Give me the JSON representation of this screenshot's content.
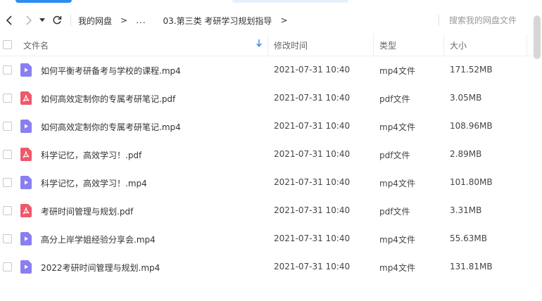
{
  "colors": {
    "accent": "#2d8cf0",
    "mp4_icon": "#8a7ff0",
    "pdf_icon": "#f0586a"
  },
  "nav": {
    "back_icon": "arrow-left-icon",
    "forward_icon": "arrow-right-icon",
    "dropdown_icon": "caret-down-icon",
    "refresh_icon": "refresh-icon"
  },
  "breadcrumb": {
    "root": "我的网盘",
    "sep": ">",
    "ellipsis": "...",
    "current": "03.第三类 考研学习规划指导",
    "trailing_sep": ">"
  },
  "search": {
    "placeholder": "搜索我的网盘文件"
  },
  "columns": {
    "name": "文件名",
    "mtime": "修改时间",
    "type": "类型",
    "size": "大小",
    "sort_icon": "sort-down-arrow-icon"
  },
  "files": [
    {
      "name": "如何平衡考研备考与学校的课程.mp4",
      "mtime": "2021-07-31 10:40",
      "type": "mp4文件",
      "size": "171.52MB",
      "icon": "video-file-icon"
    },
    {
      "name": "如何高效定制你的专属考研笔记.pdf",
      "mtime": "2021-07-31 10:40",
      "type": "pdf文件",
      "size": "3.05MB",
      "icon": "pdf-file-icon"
    },
    {
      "name": "如何高效定制你的专属考研笔记.mp4",
      "mtime": "2021-07-31 10:40",
      "type": "mp4文件",
      "size": "108.96MB",
      "icon": "video-file-icon"
    },
    {
      "name": "科学记忆，高效学习！.pdf",
      "mtime": "2021-07-31 10:40",
      "type": "pdf文件",
      "size": "2.89MB",
      "icon": "pdf-file-icon"
    },
    {
      "name": "科学记忆，高效学习！.mp4",
      "mtime": "2021-07-31 10:40",
      "type": "mp4文件",
      "size": "101.80MB",
      "icon": "video-file-icon"
    },
    {
      "name": "考研时间管理与规划.pdf",
      "mtime": "2021-07-31 10:40",
      "type": "pdf文件",
      "size": "3.31MB",
      "icon": "pdf-file-icon"
    },
    {
      "name": "高分上岸学姐经验分享会.mp4",
      "mtime": "2021-07-31 10:40",
      "type": "mp4文件",
      "size": "55.63MB",
      "icon": "video-file-icon"
    },
    {
      "name": "2022考研时间管理与规划.mp4",
      "mtime": "2021-07-31 10:40",
      "type": "mp4文件",
      "size": "131.81MB",
      "icon": "video-file-icon"
    }
  ]
}
